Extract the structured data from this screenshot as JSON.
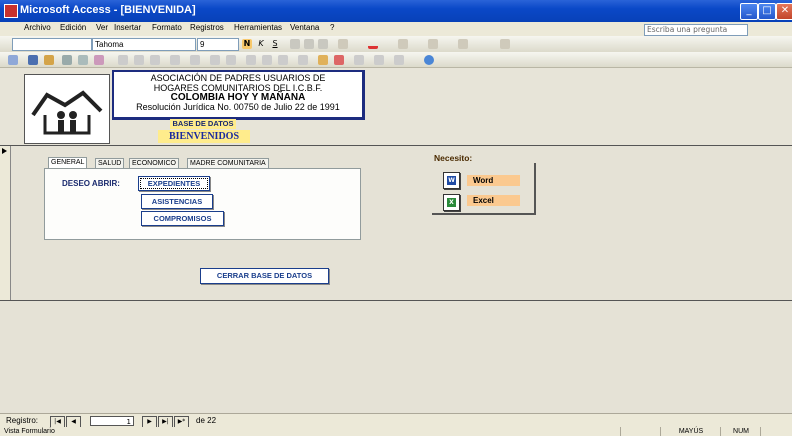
{
  "window": {
    "title": "Microsoft Access - [BIENVENIDA]"
  },
  "menu": {
    "items": [
      "Archivo",
      "Edición",
      "Ver",
      "Insertar",
      "Formato",
      "Registros",
      "Herramientas",
      "Ventana",
      "?"
    ],
    "ask_placeholder": "Escriba una pregunta"
  },
  "toolbar_format": {
    "font": "Tahoma",
    "size": "9"
  },
  "header": {
    "assoc_line1": "ASOCIACIÓN DE PADRES USUARIOS DE",
    "assoc_line2": "HOGARES COMUNITARIOS DEL I.C.B.F.",
    "assoc_line3": "COLOMBIA HOY Y MAÑANA",
    "assoc_line4": "Resolución Jurídica No. 00750 de Julio 22 de 1991",
    "base_label": "BASE DE DATOS",
    "welcome_label": "BIENVENIDOS"
  },
  "tabs": [
    "GENERAL",
    "SALUD",
    "ECONOMICO",
    "MADRE COMUNITARIA"
  ],
  "general": {
    "open_label": "DESEO ABRIR:",
    "btn_expedientes": "EXPEDIENTES",
    "btn_asistencias": "ASISTENCIAS",
    "btn_compromisos": "COMPROMISOS"
  },
  "close_db_label": "CERRAR BASE DE DATOS",
  "need": {
    "label": "Necesito:",
    "word": "Word",
    "excel": "Excel"
  },
  "navigation": {
    "record_label": "Registro:",
    "current": "1",
    "total_label": "de 22"
  },
  "status": {
    "left": "Vista Formulario",
    "caps": "MAYÚS",
    "num": "NUM"
  }
}
